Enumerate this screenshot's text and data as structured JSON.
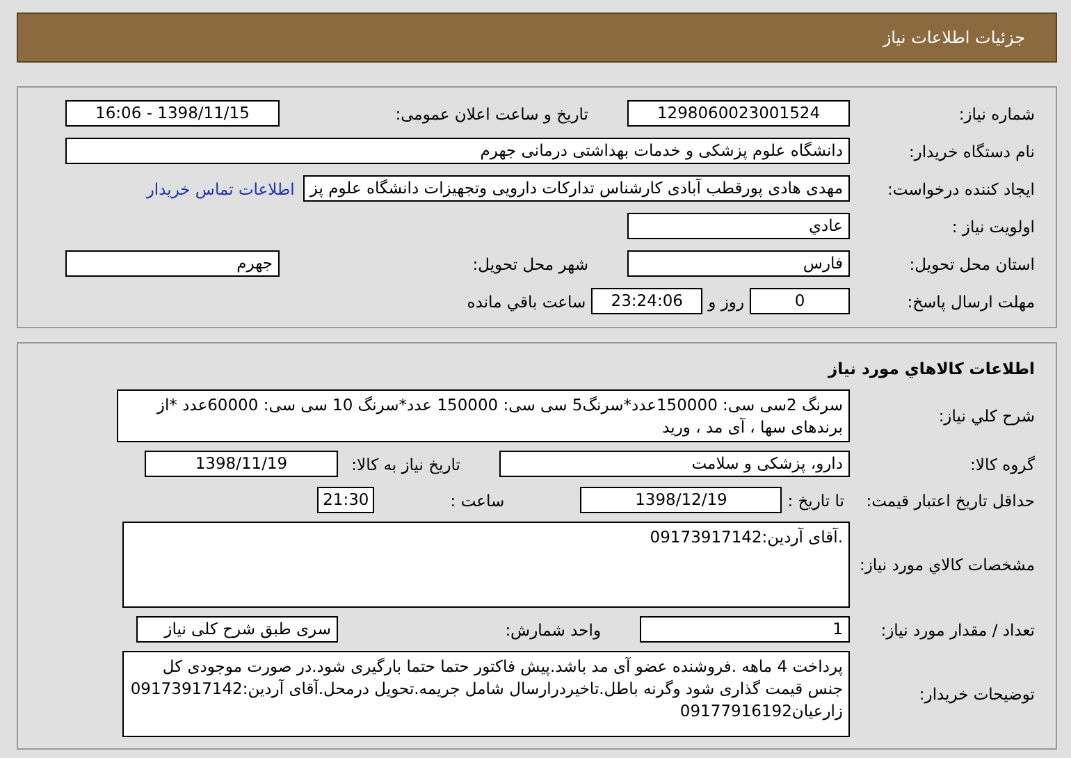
{
  "header": {
    "title": "جزئیات اطلاعات نیاز"
  },
  "need_info": {
    "need_number": {
      "label": "شماره نیاز:",
      "value": "1298060023001524"
    },
    "announce_datetime": {
      "label": "تاریخ و ساعت اعلان عمومی:",
      "value": "1398/11/15 - 16:06"
    },
    "buyer_org": {
      "label": "نام دستگاه خریدار:",
      "value": "دانشگاه علوم پزشکی و خدمات بهداشتی درمانی جهرم"
    },
    "requester": {
      "label": "ایجاد کننده درخواست:",
      "value": "مهدی هادی پورقطب آبادی کارشناس تدارکات دارویی وتجهیزات دانشگاه علوم پز"
    },
    "buyer_contact_link": "اطلاعات تماس خریدار",
    "priority": {
      "label": "اولویت نیاز :",
      "value": "عادي"
    },
    "province": {
      "label": "استان محل تحویل:",
      "value": "فارس"
    },
    "city": {
      "label": "شهر محل تحویل:",
      "value": "جهرم"
    },
    "deadline": {
      "label": "مهلت ارسال پاسخ:",
      "days": "0",
      "days_suffix": "روز و",
      "time": "23:24:06",
      "time_suffix": "ساعت باقي مانده"
    }
  },
  "goods": {
    "title": "اطلاعات کالاهاي مورد نیاز",
    "description": {
      "label": "شرح کلي نیاز:",
      "value": "سرنگ 2سی سی: 150000عدد*سرنگ5 سی سی: 150000 عدد*سرنگ 10 سی سی: 60000عدد *از برندهای سها ، آی مد ، ورید"
    },
    "goods_group": {
      "label": "گروه کالا:",
      "value": "دارو، پزشکی و سلامت"
    },
    "need_date": {
      "label": "تاریخ نیاز به کالا:",
      "value": "1398/11/19"
    },
    "price_validity": {
      "label": "حداقل تاریخ اعتبار قیمت:",
      "date_label": "تا تاریخ :",
      "date": "1398/12/19",
      "time_label": "ساعت :",
      "time": "21:30"
    },
    "specs": {
      "label": "مشخصات کالاي مورد نیاز:",
      "value": ".آقای آردین:09173917142"
    },
    "quantity": {
      "label": "تعداد / مقدار مورد نیاز:",
      "value": "1"
    },
    "unit": {
      "label": "واحد شمارش:",
      "value": "سری طبق شرح کلی نیاز"
    },
    "buyer_notes": {
      "label": "توضیحات خریدار:",
      "value": "پرداخت 4 ماهه .فروشنده عضو آی مد باشد.پیش فاکتور حتما حتما بارگیری شود.در صورت موجودی کل جنس قیمت گذاری شود وگرنه باطل.تاخیردرارسال شامل جریمه.تحویل درمحل.آقای آردین:09173917142 زارعیان09177916192"
    }
  }
}
